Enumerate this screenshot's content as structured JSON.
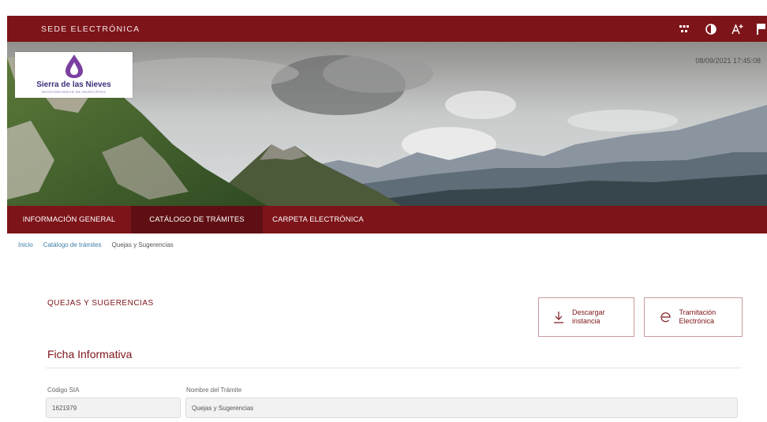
{
  "header": {
    "site_title": "SEDE ELECTRÓNICA",
    "tools": [
      "sitemap-icon",
      "contrast-icon",
      "font-size-icon",
      "flag-icon"
    ],
    "brand_color": "#7d1419"
  },
  "banner": {
    "logo_name": "Sierra de las Nieves",
    "logo_subtitle": "MANCOMUNIDAD DE MUNICIPIOS",
    "datetime": "08/09/2021 17:45:08"
  },
  "nav": {
    "items": [
      {
        "label": "INFORMACIÓN GENERAL",
        "active": false
      },
      {
        "label": "CATÁLOGO DE TRÁMITES",
        "active": true
      },
      {
        "label": "CARPETA ELECTRÓNICA",
        "active": false
      }
    ]
  },
  "breadcrumb": {
    "items": [
      "Inicio",
      "Catálogo de trámites"
    ],
    "current": "Quejas y Sugerencias"
  },
  "content": {
    "page_title": "QUEJAS Y SUGERENCIAS",
    "buttons": {
      "download": "Descargar instancia",
      "electronic": "Tramitación Electrónica"
    },
    "section_title": "Ficha Informativa",
    "fields": {
      "sia_label": "Código SIA",
      "sia_value": "1621979",
      "name_label": "Nombre del Trámite",
      "name_value": "Quejas y Sugerencias"
    }
  }
}
